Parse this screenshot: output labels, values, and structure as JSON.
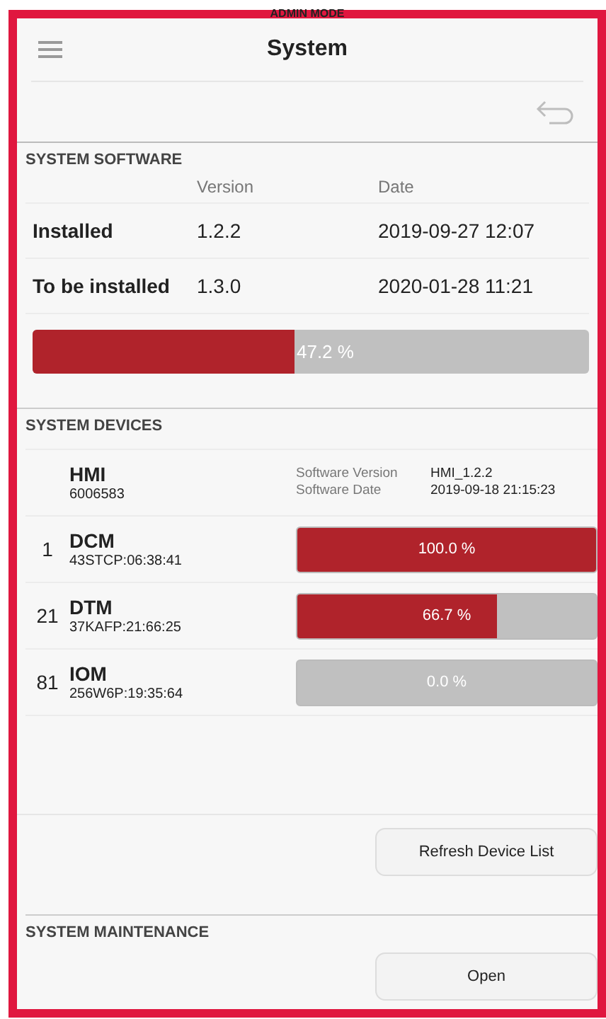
{
  "mode_banner": "ADMIN MODE",
  "header": {
    "title": "System"
  },
  "system_software": {
    "heading": "SYSTEM SOFTWARE",
    "columns": [
      "Version",
      "Date"
    ],
    "rows": [
      {
        "label": "Installed",
        "version": "1.2.2",
        "date": "2019-09-27 12:07"
      },
      {
        "label": "To be installed",
        "version": "1.3.0",
        "date": "2020-01-28 11:21"
      }
    ],
    "progress": {
      "level": 0.472,
      "reading": "47.2 %"
    }
  },
  "system_devices": {
    "heading": "SYSTEM DEVICES",
    "devices": [
      {
        "kind": "info",
        "name": "HMI",
        "serial": "6006583",
        "details": [
          {
            "label": "Software Version",
            "value": "HMI_1.2.2"
          },
          {
            "label": "Software Date",
            "value": "2019-09-18 21:15:23"
          }
        ]
      },
      {
        "kind": "progress",
        "index": "1",
        "name": "DCM",
        "serial": "43STCP:06:38:41",
        "level": 1.0,
        "reading": "100.0 %"
      },
      {
        "kind": "progress",
        "index": "21",
        "name": "DTM",
        "serial": "37KAFP:21:66:25",
        "level": 0.667,
        "reading": "66.7 %"
      },
      {
        "kind": "progress",
        "index": "81",
        "name": "IOM",
        "serial": "256W6P:19:35:64",
        "level": 0.0,
        "reading": "0.0 %"
      }
    ],
    "button": "Refresh Device List"
  },
  "system_maintenance": {
    "heading": "SYSTEM MAINTENANCE",
    "button": "Open"
  }
}
